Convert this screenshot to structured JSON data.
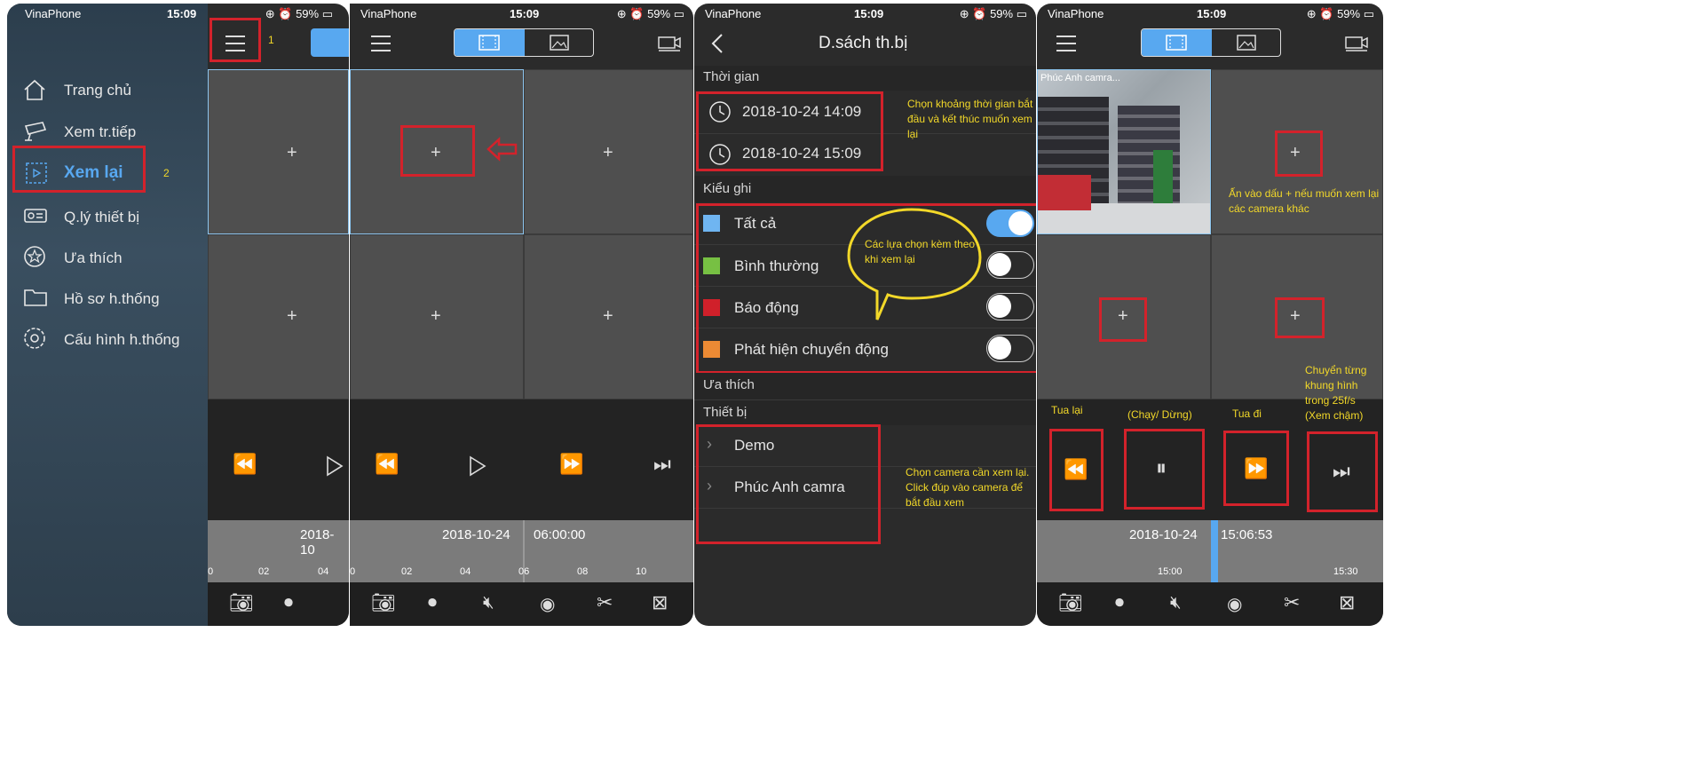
{
  "status": {
    "carrier": "VinaPhone",
    "time": "15:09",
    "battery": "59%"
  },
  "p1": {
    "menu": [
      "Trang chủ",
      "Xem tr.tiếp",
      "Xem lại",
      "Q.lý thiết bị",
      "Ưa thích",
      "Hồ sơ h.thống",
      "Cấu hình h.thống"
    ],
    "menu_icons": [
      "home-icon",
      "cctv-icon",
      "playback-icon",
      "device-icon",
      "star-icon",
      "folder-icon",
      "gear-icon"
    ],
    "active_index": 2,
    "step1": "1",
    "step2": "2",
    "timeline_date": "2018-10",
    "ticks": [
      "0",
      "02",
      "04"
    ]
  },
  "p2": {
    "timeline_date": "2018-10-24",
    "timeline_time": "06:00:00",
    "ticks": [
      "0",
      "02",
      "04",
      "06",
      "08",
      "10"
    ]
  },
  "p3": {
    "title": "D.sách th.bị",
    "section_time": "Thời gian",
    "start": "2018-10-24 14:09",
    "end": "2018-10-24 15:09",
    "time_note": "Chọn khoảng thời gian bắt đầu và kết thúc muốn xem lại",
    "section_type": "Kiểu ghi",
    "types": [
      {
        "label": "Tất cả",
        "color": "#6fb5f1",
        "on": true
      },
      {
        "label": "Bình thường",
        "color": "#77c043",
        "on": false
      },
      {
        "label": "Báo động",
        "color": "#d0202a",
        "on": false
      },
      {
        "label": "Phát hiện chuyển động",
        "color": "#ec8a34",
        "on": false
      }
    ],
    "bubble": "Các lựa chọn kèm theo khi xem lại",
    "section_fav": "Ưa thích",
    "section_device": "Thiết bị",
    "devices": [
      "Demo",
      "Phúc Anh camra"
    ],
    "device_note": "Chọn camera  cần xem lại. Click đúp vào camera để bắt đầu xem"
  },
  "p4": {
    "camera_label": "Phúc Anh camra...",
    "plus_note": "Ấn vào dấu + nếu muốn xem lại các camera khác",
    "rewind_note": "Tua lại",
    "play_note": "(Chạy/ Dừng)",
    "forward_note": "Tua đi",
    "frame_note": "Chuyển từng khung hình trong 25f/s (Xem chậm)",
    "timeline_date": "2018-10-24",
    "timeline_time": "15:06:53",
    "ticks": [
      "15:00",
      "15:30"
    ]
  },
  "colors": {
    "accent": "#58a8f0",
    "red": "#d3222b",
    "note": "#f2d829"
  }
}
